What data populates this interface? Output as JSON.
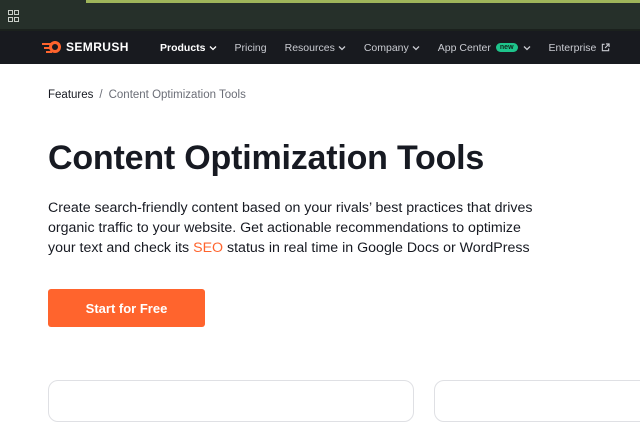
{
  "nav": {
    "logo_text": "SEMRUSH",
    "items": [
      {
        "label": "Products",
        "has_dropdown": true,
        "active": true
      },
      {
        "label": "Pricing",
        "has_dropdown": false,
        "active": false
      },
      {
        "label": "Resources",
        "has_dropdown": true,
        "active": false
      },
      {
        "label": "Company",
        "has_dropdown": true,
        "active": false
      },
      {
        "label": "App Center",
        "has_dropdown": true,
        "active": false,
        "badge": "new"
      },
      {
        "label": "Enterprise",
        "has_dropdown": false,
        "active": false,
        "external": true
      }
    ]
  },
  "breadcrumb": {
    "items": [
      "Features",
      "Content Optimization Tools"
    ],
    "separator": "/"
  },
  "hero": {
    "title": "Content Optimization Tools",
    "description_part1": "Create search-friendly content based on your rivals’ best practices that drives organic traffic to your website. Get actionable recommendations to optimize your text and check its ",
    "description_highlight": "SEO",
    "description_part2": " status in real time in Google Docs or WordPress",
    "cta_label": "Start for Free"
  },
  "colors": {
    "accent": "#ff642d",
    "nav_background": "#181a1f",
    "badge_green": "#1ec48b"
  },
  "icons": [
    "apps-grid-icon",
    "semrush-logo-icon",
    "chevron-down-icon",
    "external-link-icon"
  ]
}
